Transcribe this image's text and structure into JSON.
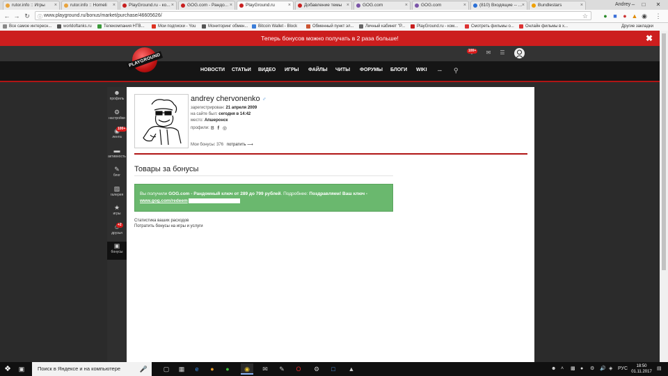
{
  "browser": {
    "tabs": [
      {
        "title": "rutor.info :: Игры",
        "color": "#e8a33d"
      },
      {
        "title": "rutor.info :: Homeli",
        "color": "#e8a33d"
      },
      {
        "title": "PlayGround.ru - ко...",
        "color": "#c81f1f"
      },
      {
        "title": "GOG.com - Рандо...",
        "color": "#c81f1f"
      },
      {
        "title": "PlayGround.ru",
        "color": "#c81f1f",
        "active": true
      },
      {
        "title": "Добавление темы",
        "color": "#c81f1f"
      },
      {
        "title": "GOG.com",
        "color": "#7b55a8"
      },
      {
        "title": "GOG.com",
        "color": "#7b55a8"
      },
      {
        "title": "(810) Входящие -- ...",
        "color": "#2a6fd6"
      },
      {
        "title": "Bundlestars",
        "color": "#f0a000"
      }
    ],
    "user": "Andrey",
    "url": "www.playground.ru/bonus/market/purchase/46605626/",
    "bookmarks": [
      {
        "label": "Все самое интересн...",
        "color": "#888"
      },
      {
        "label": "worldoftanks.ru",
        "color": "#555"
      },
      {
        "label": "Телекомпания НТВ...",
        "color": "#3a9a3a"
      },
      {
        "label": "Мои подписки - You",
        "color": "#d32"
      },
      {
        "label": "Мониторинг обмен...",
        "color": "#555"
      },
      {
        "label": "Bitcoin Wallet - Block",
        "color": "#3b7dd8"
      },
      {
        "label": "Обменный пункт эл...",
        "color": "#c53"
      },
      {
        "label": "Личный кабинет \"P...",
        "color": "#666"
      },
      {
        "label": "PlayGround.ru - ком...",
        "color": "#c81f1f"
      },
      {
        "label": "Смотреть фильмы о...",
        "color": "#d33"
      },
      {
        "label": "Онлайн фильмы в х...",
        "color": "#d33"
      }
    ],
    "bookmarks_other": "Другие закладки"
  },
  "promo": {
    "text": "Теперь бонусов можно получать в 2 раза больше!"
  },
  "site": {
    "logo": "PLAYGROUND",
    "badge": "100+",
    "menu": [
      "НОВОСТИ",
      "СТАТЬИ",
      "ВИДЕО",
      "ИГРЫ",
      "ФАЙЛЫ",
      "ЧИТЫ",
      "ФОРУМЫ",
      "БЛОГИ",
      "WIKI",
      "..."
    ]
  },
  "sidebar": [
    {
      "label": "профиль",
      "icon": "person-icon"
    },
    {
      "label": "настройки",
      "icon": "gear-icon"
    },
    {
      "label": "лента",
      "icon": "feed-icon",
      "badge": "100+"
    },
    {
      "label": "активность",
      "icon": "activity-icon"
    },
    {
      "label": "блог",
      "icon": "blog-icon"
    },
    {
      "label": "галерея",
      "icon": "gallery-icon"
    },
    {
      "label": "игры",
      "icon": "star-icon"
    },
    {
      "label": "друзья",
      "icon": "friends-icon",
      "badge": "+2"
    },
    {
      "label": "бонусы",
      "icon": "gift-icon",
      "active": true
    }
  ],
  "profile": {
    "name": "andrey chervonenko",
    "registered_label": "зарегистрирован:",
    "registered_value": "21 апреля 2009",
    "last_seen_label": "на сайте был:",
    "last_seen_value": "сегодня в 14:42",
    "place_label": "место:",
    "place_value": "Апшеронск",
    "profiles_label": "профили:",
    "bonus_label": "Мои бонусы:",
    "bonus_value": "376",
    "spend_label": "потратить ⟶"
  },
  "page": {
    "title": "Товары за бонусы",
    "message_prefix": "Вы получили ",
    "message_bold": "GOG.com - Рандомный ключ от 289 до 799 рублей",
    "message_middle": ". Подробнее: ",
    "message_bold2": "Поздравляем! Ваш ключ - ",
    "message_key": "www.gog.com/redeem",
    "link_stats": "Статистика ваших расходов",
    "link_spend": "Потратить бонусы на игры и услуги"
  },
  "taskbar": {
    "search_placeholder": "Поиск в Яндексе и на компьютере",
    "lang": "РУС",
    "time": "18:50",
    "date": "01.11.2017"
  }
}
